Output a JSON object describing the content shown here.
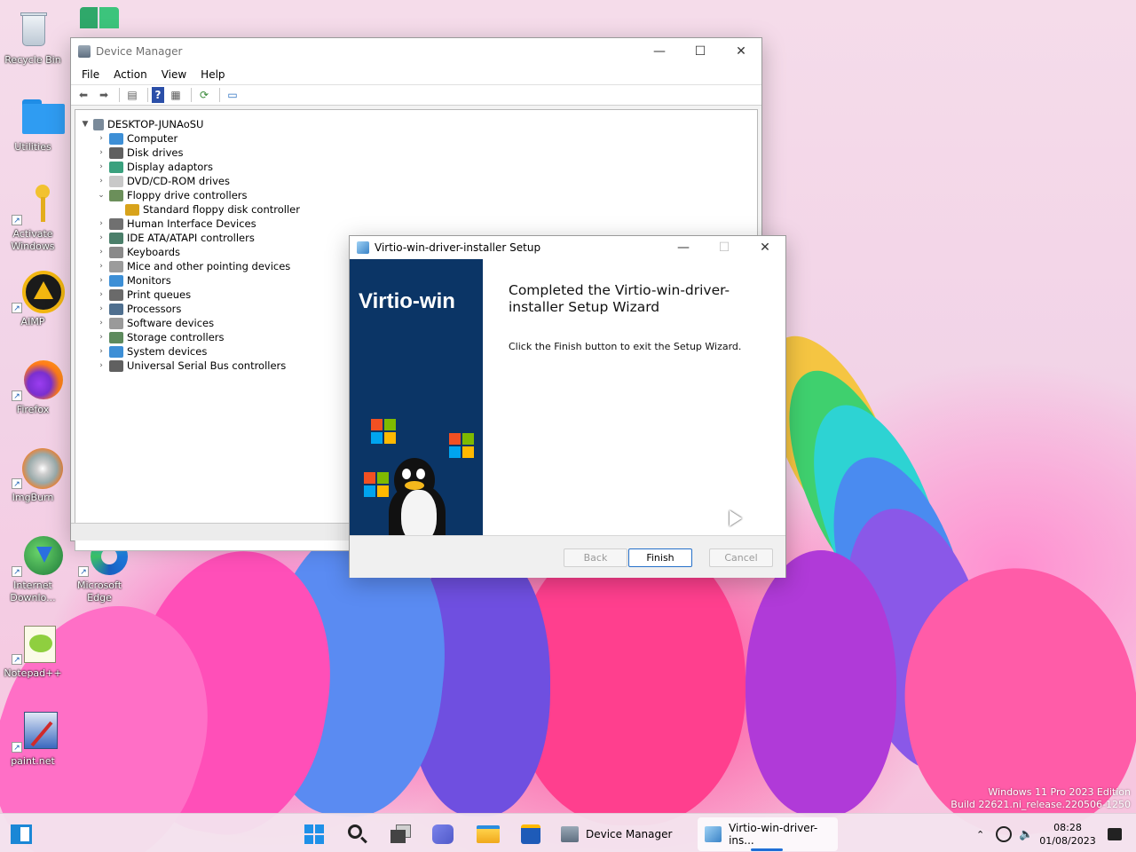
{
  "desktop": {
    "icons": [
      {
        "label": "Recycle Bin",
        "glyph": "recycle-bin-icon"
      },
      {
        "label": "Utilities",
        "glyph": "folder-icon"
      },
      {
        "label": "Activate Windows",
        "glyph": "key-icon"
      },
      {
        "label": "AIMP",
        "glyph": "aimp-icon"
      },
      {
        "label": "Firefox",
        "glyph": "firefox-icon"
      },
      {
        "label": "ImgBurn",
        "glyph": "imgburn-icon"
      },
      {
        "label": "Internet Downlo...",
        "glyph": "internet-download-icon"
      },
      {
        "label": "Microsoft Edge",
        "glyph": "edge-icon"
      },
      {
        "label": "Notepad++",
        "glyph": "notepadpp-icon"
      },
      {
        "label": "paint.net",
        "glyph": "paintnet-icon"
      }
    ],
    "watermark_line1": "Windows 11 Pro 2023 Edition",
    "watermark_line2": "Build 22621.ni_release.220506-1250"
  },
  "device_manager": {
    "title": "Device Manager",
    "menu": [
      "File",
      "Action",
      "View",
      "Help"
    ],
    "root": "DESKTOP-JUNAoSU",
    "categories": [
      {
        "label": "Computer",
        "expanded": false,
        "color": "#3d8fd6"
      },
      {
        "label": "Disk drives",
        "expanded": false,
        "color": "#606060"
      },
      {
        "label": "Display adaptors",
        "expanded": false,
        "color": "#3aa17e"
      },
      {
        "label": "DVD/CD-ROM drives",
        "expanded": false,
        "color": "#c8c8c8"
      },
      {
        "label": "Floppy drive controllers",
        "expanded": true,
        "color": "#6b8f5a"
      },
      {
        "label": "Standard floppy disk controller",
        "child": true,
        "color": "#d8a31b"
      },
      {
        "label": "Human Interface Devices",
        "expanded": false,
        "color": "#707070"
      },
      {
        "label": "IDE ATA/ATAPI controllers",
        "expanded": false,
        "color": "#4b7f6a"
      },
      {
        "label": "Keyboards",
        "expanded": false,
        "color": "#8a8a8a"
      },
      {
        "label": "Mice and other pointing devices",
        "expanded": false,
        "color": "#9b9b9b"
      },
      {
        "label": "Monitors",
        "expanded": false,
        "color": "#3d8fd6"
      },
      {
        "label": "Print queues",
        "expanded": false,
        "color": "#6a6a6a"
      },
      {
        "label": "Processors",
        "expanded": false,
        "color": "#4f6f8f"
      },
      {
        "label": "Software devices",
        "expanded": false,
        "color": "#9a9a9a"
      },
      {
        "label": "Storage controllers",
        "expanded": false,
        "color": "#5d8a5d"
      },
      {
        "label": "System devices",
        "expanded": false,
        "color": "#3d8fd6"
      },
      {
        "label": "Universal Serial Bus controllers",
        "expanded": false,
        "color": "#606060"
      }
    ]
  },
  "setup": {
    "title": "Virtio-win-driver-installer Setup",
    "brand": "Virtio-win",
    "heading": "Completed the Virtio-win-driver-installer Setup Wizard",
    "body": "Click the Finish button to exit the Setup Wizard.",
    "back": "Back",
    "finish": "Finish",
    "cancel": "Cancel"
  },
  "taskbar": {
    "device_manager_label": "Device Manager",
    "setup_label": "Virtio-win-driver-ins...",
    "time": "08:28",
    "date": "01/08/2023"
  }
}
